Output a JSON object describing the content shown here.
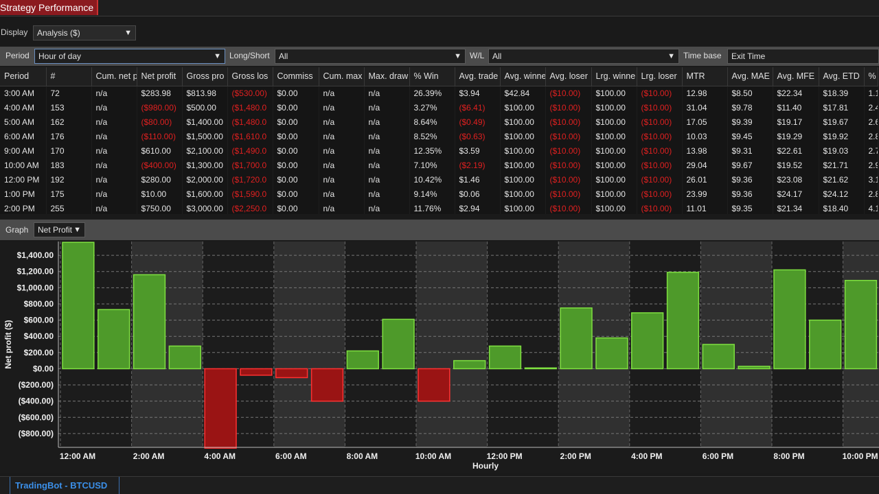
{
  "window": {
    "title": "Strategy Performance"
  },
  "display": {
    "label": "Display",
    "value": "Analysis ($)"
  },
  "filters": {
    "period_label": "Period",
    "period_value": "Hour of day",
    "longshort_label": "Long/Short",
    "longshort_value": "All",
    "wl_label": "W/L",
    "wl_value": "All",
    "timebase_label": "Time base",
    "timebase_value": "Exit Time"
  },
  "table": {
    "columns": [
      "Period",
      "#",
      "Cum. net p",
      "Net profit",
      "Gross pro",
      "Gross los",
      "Commiss",
      "Cum. max",
      "Max. draw",
      "% Win",
      "Avg. trade",
      "Avg. winne",
      "Avg. loser",
      "Lrg. winne",
      "Lrg. loser",
      "MTR",
      "Avg. MAE",
      "Avg. MFE",
      "Avg. ETD",
      "%"
    ],
    "rows": [
      [
        "3:00 AM",
        "72",
        "n/a",
        "$283.98",
        "$813.98",
        "($530.00)",
        "$0.00",
        "n/a",
        "n/a",
        "26.39%",
        "$3.94",
        "$42.84",
        "($10.00)",
        "$100.00",
        "($10.00)",
        "12.98",
        "$8.50",
        "$22.34",
        "$18.39",
        "1.1"
      ],
      [
        "4:00 AM",
        "153",
        "n/a",
        "($980.00)",
        "$500.00",
        "($1,480.0",
        "$0.00",
        "n/a",
        "n/a",
        "3.27%",
        "($6.41)",
        "$100.00",
        "($10.00)",
        "$100.00",
        "($10.00)",
        "31.04",
        "$9.78",
        "$11.40",
        "$17.81",
        "2.4"
      ],
      [
        "5:00 AM",
        "162",
        "n/a",
        "($80.00)",
        "$1,400.00",
        "($1,480.0",
        "$0.00",
        "n/a",
        "n/a",
        "8.64%",
        "($0.49)",
        "$100.00",
        "($10.00)",
        "$100.00",
        "($10.00)",
        "17.05",
        "$9.39",
        "$19.17",
        "$19.67",
        "2.6"
      ],
      [
        "6:00 AM",
        "176",
        "n/a",
        "($110.00)",
        "$1,500.00",
        "($1,610.0",
        "$0.00",
        "n/a",
        "n/a",
        "8.52%",
        "($0.63)",
        "$100.00",
        "($10.00)",
        "$100.00",
        "($10.00)",
        "10.03",
        "$9.45",
        "$19.29",
        "$19.92",
        "2.8"
      ],
      [
        "9:00 AM",
        "170",
        "n/a",
        "$610.00",
        "$2,100.00",
        "($1,490.0",
        "$0.00",
        "n/a",
        "n/a",
        "12.35%",
        "$3.59",
        "$100.00",
        "($10.00)",
        "$100.00",
        "($10.00)",
        "13.98",
        "$9.31",
        "$22.61",
        "$19.03",
        "2.7"
      ],
      [
        "10:00 AM",
        "183",
        "n/a",
        "($400.00)",
        "$1,300.00",
        "($1,700.0",
        "$0.00",
        "n/a",
        "n/a",
        "7.10%",
        "($2.19)",
        "$100.00",
        "($10.00)",
        "$100.00",
        "($10.00)",
        "29.04",
        "$9.67",
        "$19.52",
        "$21.71",
        "2.9"
      ],
      [
        "12:00 PM",
        "192",
        "n/a",
        "$280.00",
        "$2,000.00",
        "($1,720.0",
        "$0.00",
        "n/a",
        "n/a",
        "10.42%",
        "$1.46",
        "$100.00",
        "($10.00)",
        "$100.00",
        "($10.00)",
        "26.01",
        "$9.36",
        "$23.08",
        "$21.62",
        "3.1"
      ],
      [
        "1:00 PM",
        "175",
        "n/a",
        "$10.00",
        "$1,600.00",
        "($1,590.0",
        "$0.00",
        "n/a",
        "n/a",
        "9.14%",
        "$0.06",
        "$100.00",
        "($10.00)",
        "$100.00",
        "($10.00)",
        "23.99",
        "$9.36",
        "$24.17",
        "$24.12",
        "2.8"
      ],
      [
        "2:00 PM",
        "255",
        "n/a",
        "$750.00",
        "$3,000.00",
        "($2,250.0",
        "$0.00",
        "n/a",
        "n/a",
        "11.76%",
        "$2.94",
        "$100.00",
        "($10.00)",
        "$100.00",
        "($10.00)",
        "11.01",
        "$9.35",
        "$21.34",
        "$18.40",
        "4.1"
      ]
    ]
  },
  "graph": {
    "label": "Graph",
    "value": "Net Profit"
  },
  "chart_data": {
    "type": "bar",
    "ylabel": "Net profit ($)",
    "xlabel": "Hourly",
    "ylim": [
      -970,
      1570
    ],
    "yticks": [
      "$1,400.00",
      "$1,200.00",
      "$1,000.00",
      "$800.00",
      "$600.00",
      "$400.00",
      "$200.00",
      "$0.00",
      "($200.00)",
      "($400.00)",
      "($600.00)",
      "($800.00)"
    ],
    "ytick_values": [
      1400,
      1200,
      1000,
      800,
      600,
      400,
      200,
      0,
      -200,
      -400,
      -600,
      -800
    ],
    "xticks": [
      "12:00 AM",
      "2:00 AM",
      "4:00 AM",
      "6:00 AM",
      "8:00 AM",
      "10:00 AM",
      "12:00 PM",
      "2:00 PM",
      "4:00 PM",
      "6:00 PM",
      "8:00 PM",
      "10:00 PM"
    ],
    "values": [
      1560,
      730,
      1160,
      280,
      -980,
      -80,
      -110,
      -400,
      220,
      610,
      -400,
      100,
      280,
      10,
      750,
      380,
      690,
      1190,
      300,
      30,
      1220,
      600,
      1090
    ],
    "colors": {
      "positive": "#4e9a2a",
      "positive_border": "#7fe040",
      "negative": "#9a1414",
      "negative_border": "#ff3030",
      "band": "#303030"
    }
  },
  "status": {
    "tab": "TradingBot - BTCUSD"
  }
}
